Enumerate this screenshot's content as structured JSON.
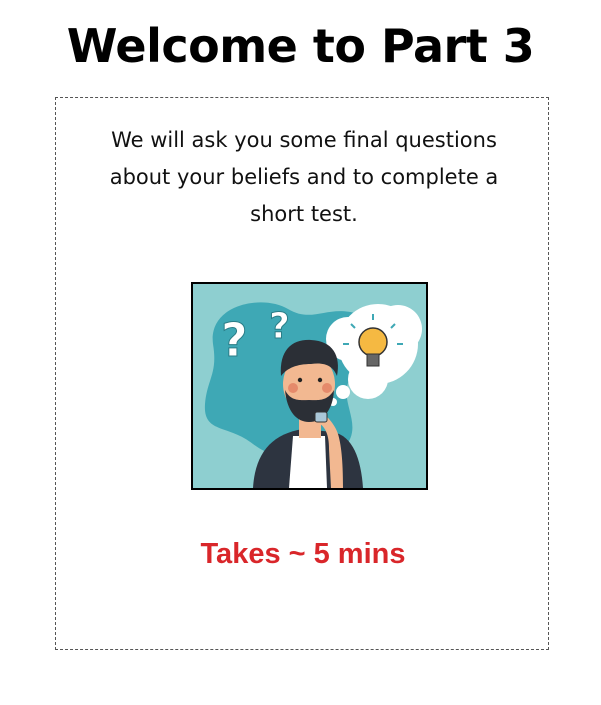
{
  "page": {
    "title": "Welcome to Part 3"
  },
  "card": {
    "intro_text": "We will ask you some final questions about your beliefs and to complete a short test.",
    "illustration": {
      "icon": "thinking-person-illustration",
      "bg_color": "#8ecfd0",
      "blob_color": "#3ea8b5"
    },
    "duration_text": "Takes ~ 5 mins",
    "duration_color": "#d9262a"
  }
}
